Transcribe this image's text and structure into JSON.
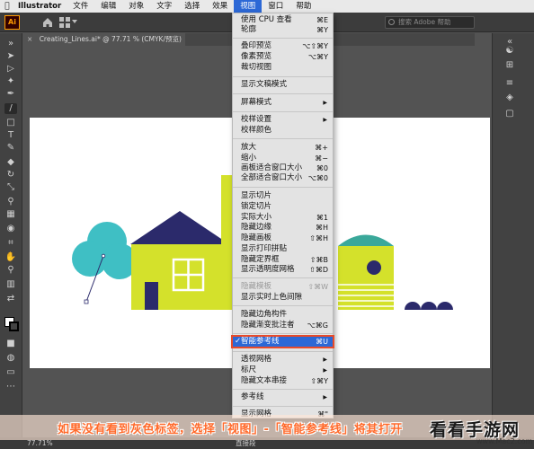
{
  "menubar": {
    "app_name": "Illustrator",
    "items": [
      "文件",
      "编辑",
      "对象",
      "文字",
      "选择",
      "效果",
      "视图",
      "窗口",
      "帮助"
    ],
    "active_item": "视图"
  },
  "appbar": {
    "logo": "Ai",
    "search_placeholder": "搜索 Adobe 帮助"
  },
  "document": {
    "tab_label": "Creating_Lines.ai* @ 77.71 % (CMYK/预览)",
    "close_glyph": "×"
  },
  "view_menu": {
    "items": [
      {
        "label": "使用 CPU 查看",
        "shortcut": "⌘E"
      },
      {
        "label": "轮廓",
        "shortcut": "⌘Y"
      },
      {
        "label": "叠印预览",
        "shortcut": "⌥⇧⌘Y"
      },
      {
        "label": "像素预览",
        "shortcut": "⌥⌘Y"
      },
      {
        "label": "裁切视图",
        "shortcut": ""
      },
      {
        "label": "显示文稿模式",
        "shortcut": ""
      },
      {
        "label": "屏幕模式",
        "shortcut": "",
        "submenu": true
      },
      {
        "label": "校样设置",
        "shortcut": "",
        "submenu": true
      },
      {
        "label": "校样颜色",
        "shortcut": ""
      },
      {
        "label": "放大",
        "shortcut": "⌘+"
      },
      {
        "label": "缩小",
        "shortcut": "⌘−"
      },
      {
        "label": "画板适合窗口大小",
        "shortcut": "⌘0"
      },
      {
        "label": "全部适合窗口大小",
        "shortcut": "⌥⌘0"
      },
      {
        "label": "显示切片",
        "shortcut": ""
      },
      {
        "label": "锁定切片",
        "shortcut": ""
      },
      {
        "label": "实际大小",
        "shortcut": "⌘1"
      },
      {
        "label": "隐藏边缘",
        "shortcut": "⌘H"
      },
      {
        "label": "隐藏画板",
        "shortcut": "⇧⌘H"
      },
      {
        "label": "显示打印拼贴",
        "shortcut": ""
      },
      {
        "label": "隐藏定界框",
        "shortcut": "⇧⌘B"
      },
      {
        "label": "显示透明度网格",
        "shortcut": "⇧⌘D"
      },
      {
        "label": "隐藏模板",
        "shortcut": "⇧⌘W",
        "disabled": true
      },
      {
        "label": "显示实时上色间隙",
        "shortcut": ""
      },
      {
        "label": "隐藏边角构件",
        "shortcut": ""
      },
      {
        "label": "隐藏渐变批注者",
        "shortcut": "⌥⌘G"
      },
      {
        "label": "智能参考线",
        "shortcut": "⌘U",
        "checked": true,
        "highlighted": true
      },
      {
        "label": "透视网格",
        "shortcut": "",
        "submenu": true
      },
      {
        "label": "标尺",
        "shortcut": "",
        "submenu": true
      },
      {
        "label": "隐藏文本串接",
        "shortcut": "⇧⌘Y"
      },
      {
        "label": "参考线",
        "shortcut": "",
        "submenu": true
      },
      {
        "label": "显示网格",
        "shortcut": "⌘\""
      }
    ],
    "check_glyph": "✓",
    "arrow_glyph": "▶"
  },
  "status": {
    "zoom": "77.71%",
    "tool": "直接段"
  },
  "banner": {
    "text": "如果没有看到灰色标签，选择「视图」-「智能参考线」将其打开"
  },
  "watermark": {
    "main": "看看手游网",
    "sub": "www.Mac2.com"
  },
  "colors": {
    "accent": "#2c68d6",
    "highlight_outline": "#e84b2a",
    "house_green": "#d4e12b",
    "roof_navy": "#2b2a6b",
    "tree_teal": "#3fbfc4",
    "banner_text": "#ff6a2b"
  }
}
